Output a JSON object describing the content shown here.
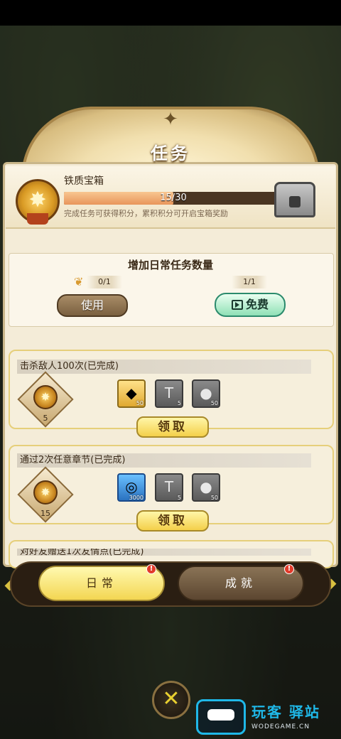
{
  "panel": {
    "title": "任务"
  },
  "chest": {
    "name": "铁质宝箱",
    "progress_text": "15/30",
    "progress_fraction": 0.5,
    "description": "完成任务可获得积分，累积积分可开启宝箱奖励"
  },
  "add_tasks": {
    "title": "增加日常任务数量",
    "use_count": "0/1",
    "use_label": "使用",
    "free_count": "1/1",
    "free_label": "免费"
  },
  "tasks": [
    {
      "name": "击杀敌人100次(已完成)",
      "points": "5",
      "rewards": [
        {
          "icon": "gem-icon",
          "qty": "50"
        },
        {
          "icon": "hammer-icon",
          "qty": "5"
        },
        {
          "icon": "potion-icon",
          "qty": "50"
        }
      ],
      "claim_label": "领取"
    },
    {
      "name": "通过2次任意章节(已完成)",
      "points": "15",
      "rewards": [
        {
          "icon": "coin-icon",
          "qty": "3000"
        },
        {
          "icon": "hammer-icon",
          "qty": "5"
        },
        {
          "icon": "potion-icon",
          "qty": "50"
        }
      ],
      "claim_label": "领取"
    }
  ],
  "partial_task": "对好友赠送1次友情点(已完成)",
  "tabs": {
    "daily": "日常",
    "achievements": "成就",
    "badge": "!"
  },
  "watermark": {
    "title": "玩客 驿站",
    "sub": "WODEGAME.CN"
  },
  "colors": {
    "accent_gold": "#f3d652",
    "progress": "#e8955a",
    "free_button": "#8fe0b6",
    "badge": "#e23a2a"
  }
}
